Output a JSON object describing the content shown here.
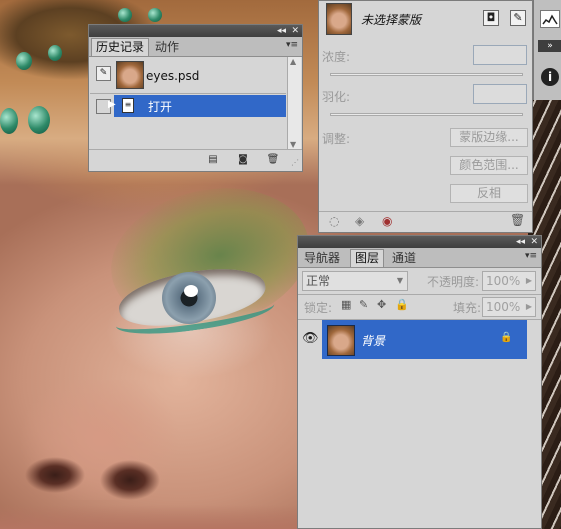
{
  "history_panel": {
    "tabs": [
      "历史记录",
      "动作"
    ],
    "snapshot_name": "eyes.psd",
    "steps": [
      {
        "label": "打开"
      }
    ]
  },
  "masks_panel": {
    "title": "未选择蒙版",
    "density_label": "浓度:",
    "feather_label": "羽化:",
    "refine_label": "调整:",
    "buttons": {
      "mask_edge": "蒙版边缘...",
      "color_range": "颜色范围...",
      "invert": "反相"
    }
  },
  "layers_panel": {
    "tabs": [
      "导航器",
      "图层",
      "通道"
    ],
    "blend_mode": "正常",
    "opacity_label": "不透明度:",
    "opacity_value": "100%",
    "lock_label": "锁定:",
    "fill_label": "填充:",
    "fill_value": "100%",
    "layers": [
      {
        "name": "背景",
        "locked": true,
        "visible": true
      }
    ]
  },
  "colors": {
    "selection": "#3168c8",
    "panel_bg": "#d6d6d6",
    "titlebar": "#4a4a4a"
  }
}
